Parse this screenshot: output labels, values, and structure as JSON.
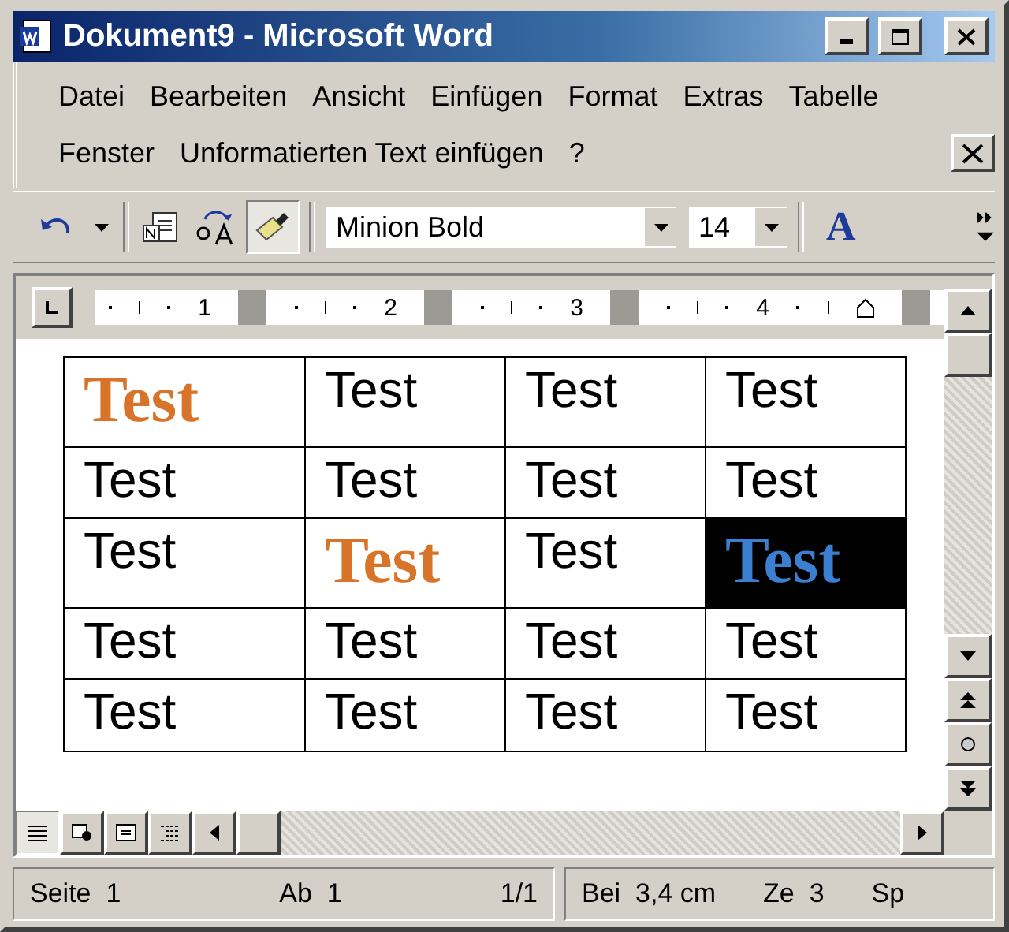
{
  "window": {
    "title": "Dokument9 - Microsoft Word"
  },
  "menu_rows": [
    [
      "Datei",
      "Bearbeiten",
      "Ansicht",
      "Einfügen",
      "Format",
      "Extras",
      "Tabelle"
    ],
    [
      "Fenster",
      "Unformatierten Text einfügen",
      "?"
    ]
  ],
  "toolbar": {
    "format_painter_pressed": true,
    "font": "Minion Bold",
    "size": "14",
    "font_color_glyph": "A"
  },
  "ruler": {
    "labels": [
      "1",
      "2",
      "3",
      "4"
    ]
  },
  "table": {
    "rows": [
      [
        {
          "text": "Test",
          "kind": "accent"
        },
        {
          "text": "Test",
          "kind": "plain"
        },
        {
          "text": "Test",
          "kind": "plain"
        },
        {
          "text": "Test",
          "kind": "plain"
        }
      ],
      [
        {
          "text": "Test",
          "kind": "plain"
        },
        {
          "text": "Test",
          "kind": "plain"
        },
        {
          "text": "Test",
          "kind": "plain"
        },
        {
          "text": "Test",
          "kind": "plain"
        }
      ],
      [
        {
          "text": "Test",
          "kind": "plain"
        },
        {
          "text": "Test",
          "kind": "accent"
        },
        {
          "text": "Test",
          "kind": "plain"
        },
        {
          "text": "Test",
          "kind": "inverse"
        }
      ],
      [
        {
          "text": "Test",
          "kind": "plain"
        },
        {
          "text": "Test",
          "kind": "plain"
        },
        {
          "text": "Test",
          "kind": "plain"
        },
        {
          "text": "Test",
          "kind": "plain"
        }
      ],
      [
        {
          "text": "Test",
          "kind": "plain"
        },
        {
          "text": "Test",
          "kind": "plain"
        },
        {
          "text": "Test",
          "kind": "plain"
        },
        {
          "text": "Test",
          "kind": "plain"
        }
      ]
    ]
  },
  "status_bar": {
    "left": [
      "Seite  1",
      "Ab  1",
      "1/1"
    ],
    "right": [
      "Bei  3,4 cm",
      "Ze  3",
      "Sp"
    ]
  }
}
